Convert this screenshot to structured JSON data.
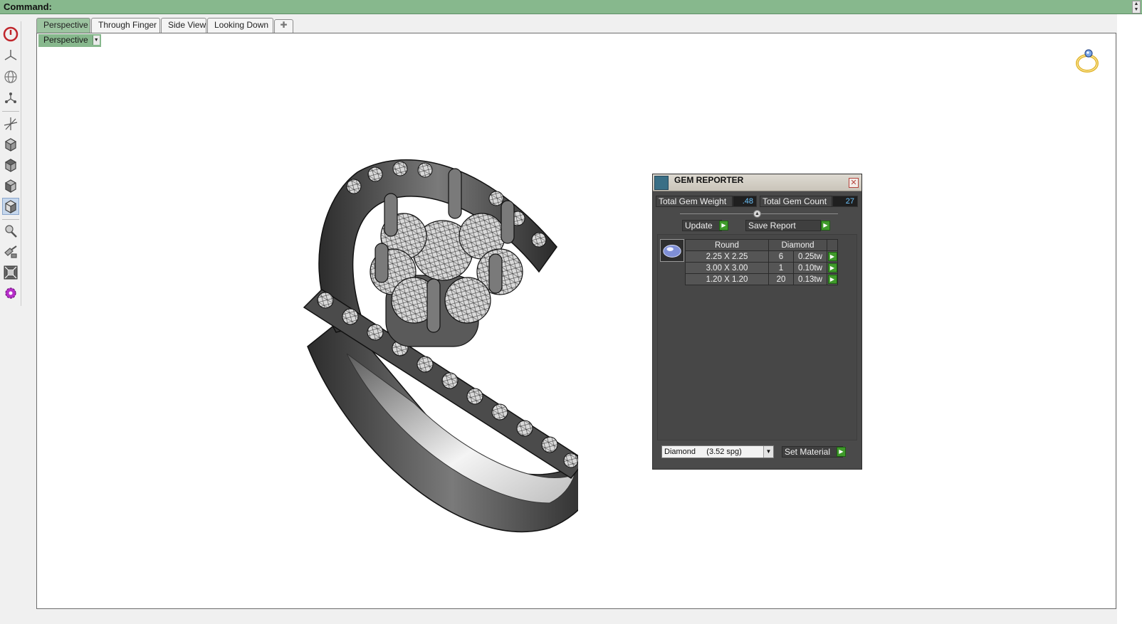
{
  "command_bar": {
    "label": "Command:"
  },
  "tabs": [
    {
      "label": "Perspective",
      "active": true
    },
    {
      "label": "Through Finger",
      "active": false
    },
    {
      "label": "Side View",
      "active": false
    },
    {
      "label": "Looking Down",
      "active": false
    }
  ],
  "viewport": {
    "label": "Perspective"
  },
  "left_toolbar": [
    "power-icon",
    "axes-icon",
    "globe-grid-icon",
    "nodes-icon",
    "transform-axes-icon",
    "cube-view-icon",
    "cube-top-icon",
    "cube-front-icon",
    "cube-persp-icon",
    "render-brush-icon",
    "material-brush-icon",
    "zoom-extents-icon",
    "gear-settings-icon"
  ],
  "gem_reporter": {
    "title": "GEM REPORTER",
    "total_weight_label": "Total Gem Weight",
    "total_weight_value": ".48",
    "total_count_label": "Total Gem Count",
    "total_count_value": "27",
    "update_label": "Update",
    "save_report_label": "Save Report",
    "table": {
      "headers": [
        "Round",
        "Diamond"
      ],
      "rows": [
        {
          "size": "2.25 X 2.25",
          "count": "6",
          "weight": "0.25tw"
        },
        {
          "size": "3.00 X 3.00",
          "count": "1",
          "weight": "0.10tw"
        },
        {
          "size": "1.20 X 1.20",
          "count": "20",
          "weight": "0.13tw"
        }
      ]
    },
    "material_value": "Diamond     (3.52 spg)",
    "set_material_label": "Set Material"
  },
  "colors": {
    "command_bar": "#87b88d",
    "active_tab": "#9cc4a0",
    "panel_bg": "#4a4a4a",
    "play_button": "#3f9a2a",
    "value_text": "#6cc5ff"
  }
}
